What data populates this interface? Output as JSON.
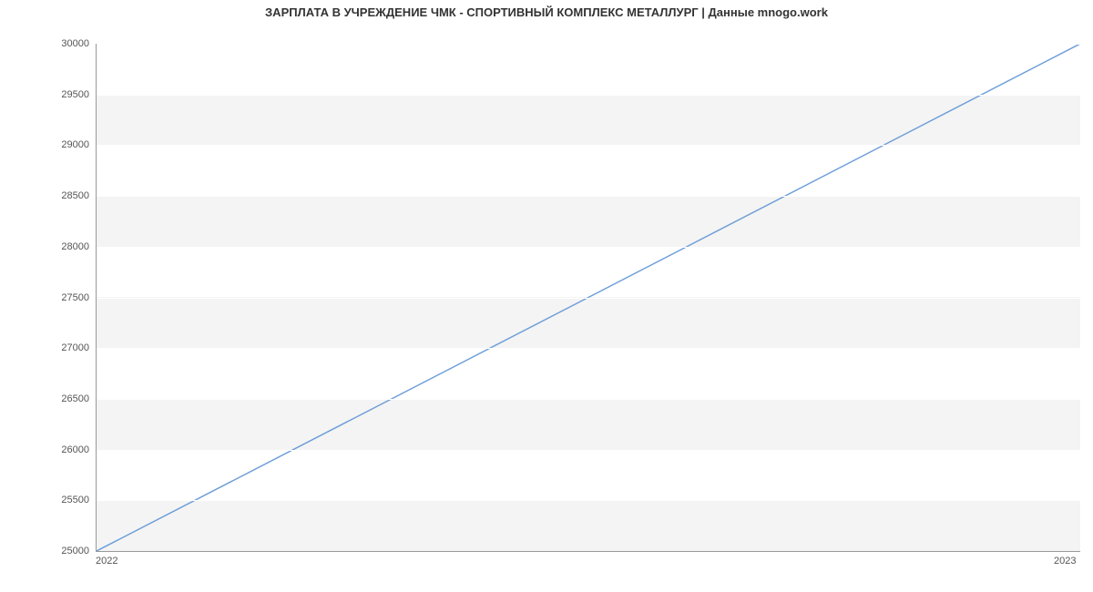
{
  "chart_data": {
    "type": "line",
    "title": "ЗАРПЛАТА В УЧРЕЖДЕНИЕ  ЧМК - СПОРТИВНЫЙ КОМПЛЕКС МЕТАЛЛУРГ | Данные mnogo.work",
    "x": [
      2022,
      2023
    ],
    "values": [
      25000,
      30000
    ],
    "xlabel": "",
    "ylabel": "",
    "ylim": [
      25000,
      30000
    ],
    "xticks": [
      "2022",
      "2023"
    ],
    "yticks": [
      25000,
      25500,
      26000,
      26500,
      27000,
      27500,
      28000,
      28500,
      29000,
      29500,
      30000
    ],
    "line_color": "#6f9fd8"
  }
}
